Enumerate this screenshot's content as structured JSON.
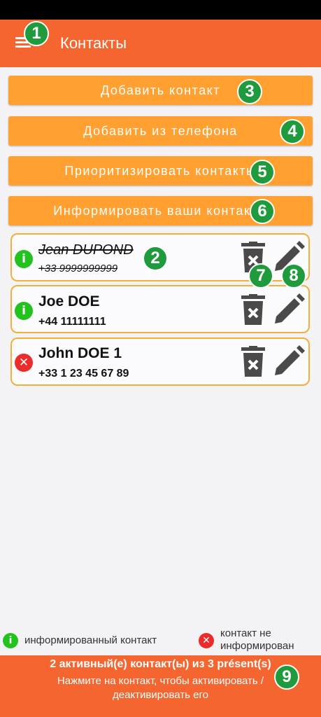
{
  "app": {
    "title": "Контакты",
    "menu_icon": "hamburger-menu-icon"
  },
  "buttons": {
    "add_contact": "Добавить контакт",
    "add_from_phone": "Добавить из телефона",
    "prioritize": "Приоритизировать контакты",
    "inform": "Информировать ваши контакты"
  },
  "contacts": [
    {
      "name": "Jean DUPOND",
      "phone": "+33 9999999999",
      "status": "informed",
      "active": false
    },
    {
      "name": "Joe DOE",
      "phone": "+44 11111111",
      "status": "informed",
      "active": true
    },
    {
      "name": "John DOE 1",
      "phone": "+33 1 23 45 67 89",
      "status": "not-informed",
      "active": true
    }
  ],
  "legend": {
    "informed": "информированный контакт",
    "not_informed": "контакт не информирован"
  },
  "footer": {
    "count": "2 активный(е) контакт(ы) из 3 présent(s)",
    "hint": "Нажмите на контакт, чтобы активировать / деактивировать его"
  },
  "annotations": [
    "1",
    "2",
    "3",
    "4",
    "5",
    "6",
    "7",
    "8",
    "9"
  ],
  "colors": {
    "appbar": "#f4652f",
    "button": "#ffa030",
    "card_border": "#f2b03a",
    "informed": "#22c21f",
    "not_informed": "#ec2b2b",
    "badge": "#1f9a3c"
  }
}
